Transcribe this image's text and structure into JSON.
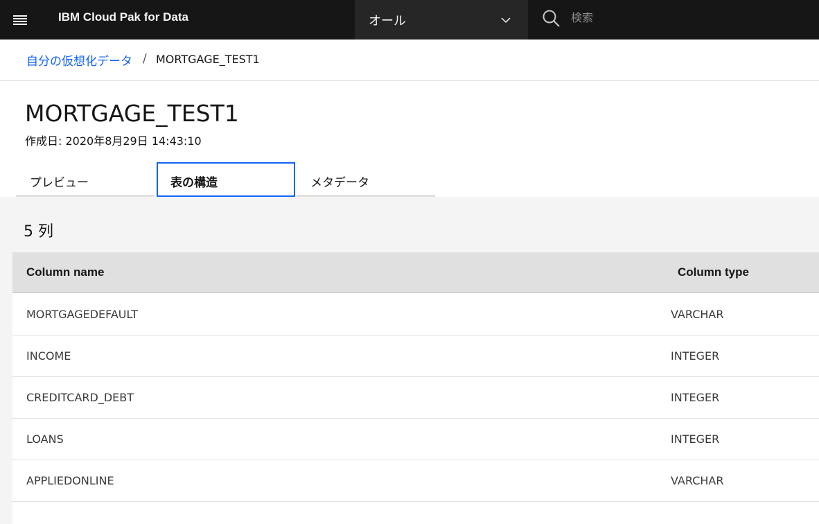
{
  "header": {
    "brand": "IBM Cloud Pak for Data",
    "scope_selected": "オール",
    "search_placeholder": "検索"
  },
  "breadcrumb": {
    "parent": "自分の仮想化データ",
    "separator": "/",
    "current": "MORTGAGE_TEST1"
  },
  "page": {
    "title": "MORTGAGE_TEST1",
    "created": "作成日: 2020年8月29日 14:43:10"
  },
  "tabs": [
    {
      "label": "プレビュー",
      "active": false
    },
    {
      "label": "表の構造",
      "active": true
    },
    {
      "label": "メタデータ",
      "active": false
    }
  ],
  "structure": {
    "column_count": "5 列",
    "headers": {
      "name": "Column name",
      "type": "Column type"
    },
    "rows": [
      {
        "name": "MORTGAGEDEFAULT",
        "type": "VARCHAR"
      },
      {
        "name": "INCOME",
        "type": "INTEGER"
      },
      {
        "name": "CREDITCARD_DEBT",
        "type": "INTEGER"
      },
      {
        "name": "LOANS",
        "type": "INTEGER"
      },
      {
        "name": "APPLIEDONLINE",
        "type": "VARCHAR"
      }
    ]
  },
  "colors": {
    "header_bg": "#161616",
    "link": "#0f62fe",
    "active_tab_border": "#0f62fe",
    "content_bg": "#f4f4f4"
  },
  "icons": {
    "menu": "hamburger-menu-icon",
    "scope": "chevron-down-icon",
    "search": "search-icon"
  }
}
